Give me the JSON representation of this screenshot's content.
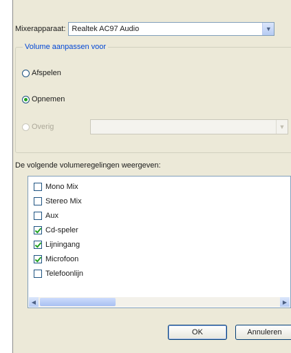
{
  "mixer": {
    "label": "Mixerapparaat:",
    "device": "Realtek AC97 Audio"
  },
  "volume_group": {
    "legend": "Volume aanpassen voor",
    "options": [
      {
        "label": "Afspelen",
        "selected": false,
        "enabled": true
      },
      {
        "label": "Opnemen",
        "selected": true,
        "enabled": true
      },
      {
        "label": "Overig",
        "selected": false,
        "enabled": false
      }
    ],
    "other_select_value": ""
  },
  "controls": {
    "label": "De volgende volumeregelingen weergeven:",
    "items": [
      {
        "label": "Mono Mix",
        "checked": false
      },
      {
        "label": "Stereo Mix",
        "checked": false
      },
      {
        "label": "Aux",
        "checked": false
      },
      {
        "label": "Cd-speler",
        "checked": true
      },
      {
        "label": "Lijningang",
        "checked": true
      },
      {
        "label": "Microfoon",
        "checked": true
      },
      {
        "label": "Telefoonlijn",
        "checked": false
      }
    ]
  },
  "buttons": {
    "ok": "OK",
    "cancel": "Annuleren"
  },
  "icons": {
    "dropdown": "chevron-down-icon",
    "scroll_left": "arrow-left-icon",
    "scroll_right": "arrow-right-icon"
  },
  "colors": {
    "dialog_bg": "#ece9d8",
    "legend_text": "#0046d5",
    "check_mark": "#21a121"
  }
}
